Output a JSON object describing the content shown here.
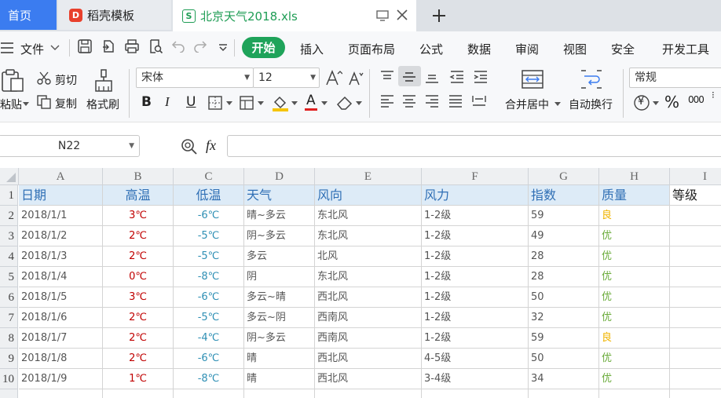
{
  "tabs": {
    "home": "首页",
    "daoke": "稻壳模板",
    "file": "北京天气2018.xls",
    "daoke_logo": "D",
    "file_logo": "S"
  },
  "menu": {
    "file": "文件",
    "start": "开始",
    "insert": "插入",
    "layout": "页面布局",
    "formula": "公式",
    "data": "数据",
    "review": "审阅",
    "view": "视图",
    "security": "安全",
    "developer": "开发工具"
  },
  "ribbon": {
    "paste": "粘贴",
    "cut": "剪切",
    "copy": "复制",
    "format_painter": "格式刷",
    "font_name": "宋体",
    "font_size": "12",
    "merge_center": "合并居中",
    "wrap_text": "自动换行",
    "number_format": "常规",
    "bold": "B",
    "italic": "I",
    "underline": "U",
    "font_color_letter": "A",
    "percent": "%",
    "thousands": "000",
    "currency": "¥",
    "accent_color": "#1fa35a",
    "home_tab_color": "#3b7cf0"
  },
  "formula_bar": {
    "cell_ref": "N22",
    "fx": "fx",
    "value": ""
  },
  "grid": {
    "columns": [
      "A",
      "B",
      "C",
      "D",
      "E",
      "F",
      "G",
      "H",
      "I"
    ],
    "header_row": {
      "row_num": "1",
      "cells": [
        "日期",
        "高温",
        "低温",
        "天气",
        "风向",
        "风力",
        "指数",
        "质量",
        "等级"
      ]
    },
    "rows": [
      {
        "row_num": "2",
        "date": "2018/1/1",
        "high": "3℃",
        "low": "-6℃",
        "weather": "晴~多云",
        "wind_dir": "东北风",
        "wind_force": "1-2级",
        "index": "59",
        "quality": "良"
      },
      {
        "row_num": "3",
        "date": "2018/1/2",
        "high": "2℃",
        "low": "-5℃",
        "weather": "阴~多云",
        "wind_dir": "东北风",
        "wind_force": "1-2级",
        "index": "49",
        "quality": "优"
      },
      {
        "row_num": "4",
        "date": "2018/1/3",
        "high": "2℃",
        "low": "-5℃",
        "weather": "多云",
        "wind_dir": "北风",
        "wind_force": "1-2级",
        "index": "28",
        "quality": "优"
      },
      {
        "row_num": "5",
        "date": "2018/1/4",
        "high": "0℃",
        "low": "-8℃",
        "weather": "阴",
        "wind_dir": "东北风",
        "wind_force": "1-2级",
        "index": "28",
        "quality": "优"
      },
      {
        "row_num": "6",
        "date": "2018/1/5",
        "high": "3℃",
        "low": "-6℃",
        "weather": "多云~晴",
        "wind_dir": "西北风",
        "wind_force": "1-2级",
        "index": "50",
        "quality": "优"
      },
      {
        "row_num": "7",
        "date": "2018/1/6",
        "high": "2℃",
        "low": "-5℃",
        "weather": "多云~阴",
        "wind_dir": "西南风",
        "wind_force": "1-2级",
        "index": "32",
        "quality": "优"
      },
      {
        "row_num": "8",
        "date": "2018/1/7",
        "high": "2℃",
        "low": "-4℃",
        "weather": "阴~多云",
        "wind_dir": "西南风",
        "wind_force": "1-2级",
        "index": "59",
        "quality": "良"
      },
      {
        "row_num": "9",
        "date": "2018/1/8",
        "high": "2℃",
        "low": "-6℃",
        "weather": "晴",
        "wind_dir": "西北风",
        "wind_force": "4-5级",
        "index": "50",
        "quality": "优"
      },
      {
        "row_num": "10",
        "date": "2018/1/9",
        "high": "1℃",
        "low": "-8℃",
        "weather": "晴",
        "wind_dir": "西北风",
        "wind_force": "3-4级",
        "index": "34",
        "quality": "优"
      }
    ],
    "colors": {
      "high": "#c00000",
      "low": "#2e8fb4",
      "quality_good": "#f0b400",
      "quality_excellent": "#6aab3a",
      "header_fill": "#ddebf7",
      "header_text": "#2f6fb5"
    }
  }
}
